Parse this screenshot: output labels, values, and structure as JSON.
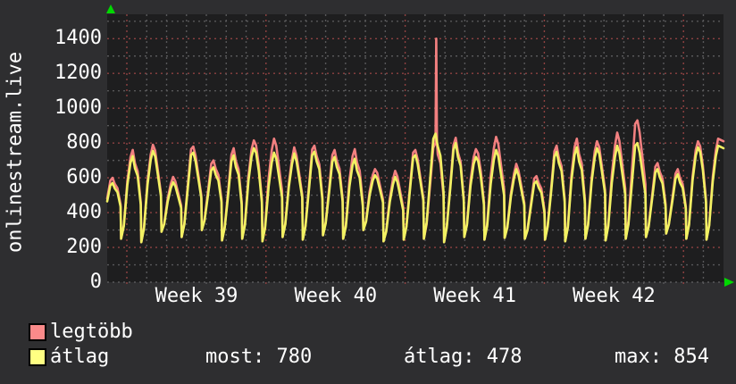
{
  "window": {
    "bg_color": "#2e2e30",
    "canvas_color": "#1e1e1f",
    "text_color": "#ffffff"
  },
  "title_vertical": "onlinestream.live",
  "chart_data": {
    "type": "line",
    "title": "onlinestream.live",
    "xlabel": "",
    "ylabel": "",
    "ylim": [
      0,
      1540
    ],
    "y_ticks": [
      0,
      200,
      400,
      600,
      800,
      1000,
      1200,
      1400
    ],
    "x_tick_labels": [
      "Week 39",
      "Week 40",
      "Week 41",
      "Week 42"
    ],
    "grid": {
      "minor_color": "#58585a",
      "major_color": "#8f4242",
      "on": true
    },
    "axis_arrow_color": "#00d800",
    "days": 31,
    "day_troughs": [
      330,
      250,
      230,
      290,
      260,
      300,
      240,
      250,
      235,
      260,
      245,
      270,
      250,
      300,
      235,
      245,
      250,
      230,
      260,
      245,
      255,
      250,
      245,
      235,
      250,
      240,
      250,
      260,
      280,
      250,
      245
    ],
    "series": [
      {
        "name": "legtöbb",
        "line_color": "#f28080",
        "day_peaks": [
          600,
          760,
          790,
          605,
          780,
          700,
          770,
          815,
          825,
          775,
          785,
          760,
          765,
          650,
          640,
          760,
          800,
          830,
          765,
          835,
          680,
          610,
          785,
          825,
          810,
          860,
          930,
          685,
          650,
          810,
          825
        ],
        "spike": {
          "day_index": 16,
          "value": 1400
        }
      },
      {
        "name": "átlag",
        "line_color": "#f2f163",
        "day_peaks": [
          570,
          725,
          755,
          575,
          745,
          660,
          730,
          770,
          745,
          740,
          750,
          720,
          710,
          615,
          605,
          730,
          854,
          800,
          720,
          760,
          650,
          580,
          750,
          775,
          770,
          785,
          800,
          650,
          620,
          775,
          785
        ]
      }
    ]
  },
  "legend": {
    "items": [
      {
        "label": "legtöbb",
        "color": "#fa8a8a"
      },
      {
        "label": "átlag",
        "color": "#ffff82"
      }
    ]
  },
  "stats": [
    {
      "text": "most: 780"
    },
    {
      "text": "átlag: 478"
    },
    {
      "text": "max: 854"
    }
  ]
}
